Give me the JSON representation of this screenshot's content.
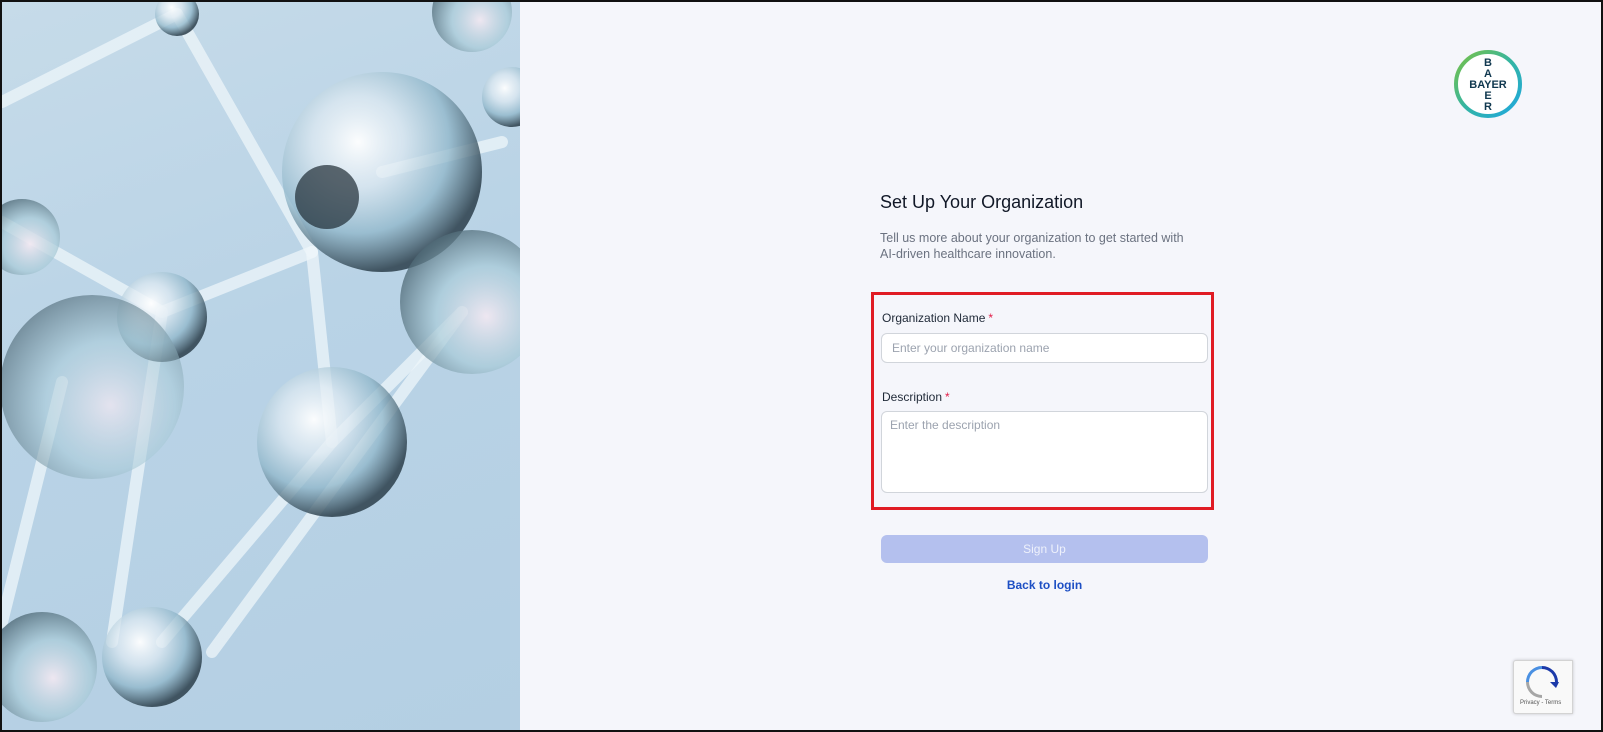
{
  "brand": {
    "logo_text": "BAYER"
  },
  "form": {
    "title": "Set Up Your Organization",
    "subtitle": "Tell us more about your organization to get started with AI-driven healthcare innovation.",
    "org_name": {
      "label": "Organization Name",
      "required": "*",
      "placeholder": "Enter your organization name",
      "value": ""
    },
    "description": {
      "label": "Description",
      "required": "*",
      "placeholder": "Enter the description",
      "value": ""
    },
    "submit_label": "Sign Up",
    "back_label": "Back to login"
  },
  "recaptcha": {
    "text": "Privacy - Terms"
  },
  "colors": {
    "accent": "#1d4fc4",
    "button_disabled": "#b4c0ee",
    "highlight": "#e01b24"
  }
}
